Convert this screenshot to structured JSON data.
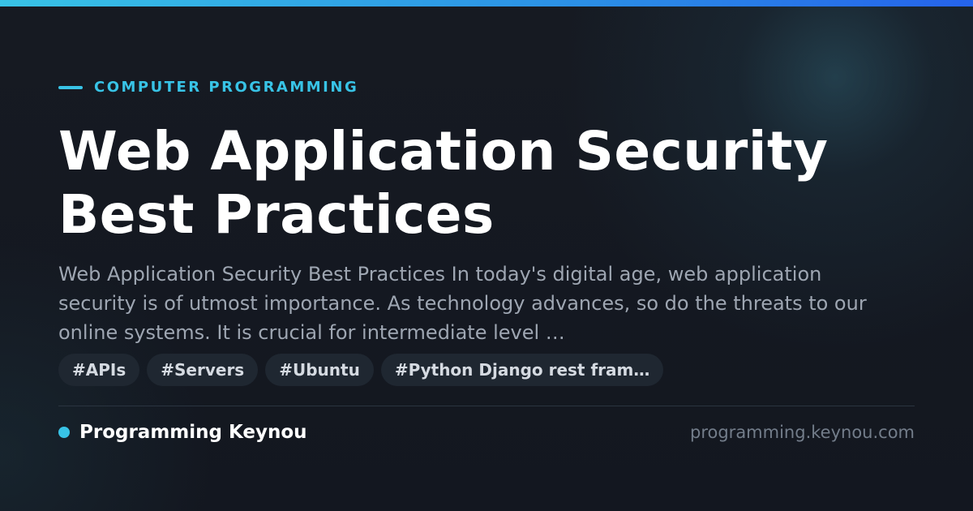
{
  "category": {
    "label": "COMPUTER PROGRAMMING"
  },
  "article": {
    "title": "Web Application Security Best Practices",
    "excerpt": "Web Application Security Best Practices In today's digital age, web application security is of utmost importance. As technology advances, so do the threats to our online systems. It is crucial for intermediate level …"
  },
  "tags": [
    "#APIs",
    "#Servers",
    "#Ubuntu",
    "#Python Django rest fram…"
  ],
  "footer": {
    "site_name": "Programming Keynou",
    "site_url": "programming.keynou.com"
  },
  "colors": {
    "accent": "#38c3e6",
    "background": "#141820",
    "tag_background": "#1f2731",
    "muted_text": "#9ea6b2"
  }
}
